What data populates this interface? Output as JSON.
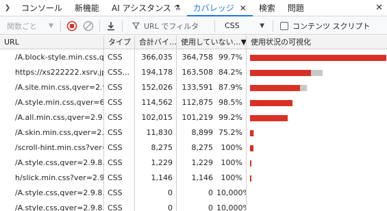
{
  "tabs": [
    {
      "label": "コンソール",
      "active": false,
      "closable": false,
      "flask": false
    },
    {
      "label": "新機能",
      "active": false,
      "closable": false,
      "flask": false
    },
    {
      "label": "AI アシスタンス",
      "active": false,
      "closable": false,
      "flask": true
    },
    {
      "label": "カバレッジ",
      "active": true,
      "closable": true,
      "flask": false
    },
    {
      "label": "検索",
      "active": false,
      "closable": false,
      "flask": false
    },
    {
      "label": "問題",
      "active": false,
      "closable": false,
      "flask": false
    }
  ],
  "toolbar": {
    "granularity": "関数ごと",
    "filter_placeholder": "URL でフィルタ",
    "type_value": "CSS",
    "content_scripts_label": "コンテンツ スクリプト",
    "content_scripts_checked": false
  },
  "table": {
    "headers": [
      "URL",
      "タイプ",
      "合計バイ…",
      "使用していない…▼",
      "使用状況の可視化"
    ],
    "rows": [
      {
        "url": "/A.block-style.min.css,qver=",
        "type": "CSS",
        "total": "366,035",
        "unused": "364,758",
        "pct": "99.7%",
        "used_frac": 0.0035,
        "size_frac": 1.0
      },
      {
        "url": "https://xs222222.xsrv.jp/",
        "type": "CSS...",
        "total": "194,178",
        "unused": "163,508",
        "pct": "84.2%",
        "used_frac": 0.158,
        "size_frac": 0.5305
      },
      {
        "url": "/A.site.min.css,qver=2.9.8.1",
        "type": "CSS",
        "total": "152,026",
        "unused": "133,591",
        "pct": "87.9%",
        "used_frac": 0.121,
        "size_frac": 0.4153
      },
      {
        "url": "/A.style.min.css,qver=6.7.1",
        "type": "CSS",
        "total": "114,562",
        "unused": "112,875",
        "pct": "98.5%",
        "used_frac": 0.015,
        "size_frac": 0.313
      },
      {
        "url": "/A.all.min.css,qver=2.9.8.1",
        "type": "CSS",
        "total": "102,015",
        "unused": "101,219",
        "pct": "99.2%",
        "used_frac": 0.008,
        "size_frac": 0.2787
      },
      {
        "url": "/A.skin.min.css,qver=2.9.8",
        "type": "CSS",
        "total": "11,830",
        "unused": "8,899",
        "pct": "75.2%",
        "used_frac": 0.248,
        "size_frac": 0.0323
      },
      {
        "url": "/scroll-hint.min.css?ver=2.",
        "type": "CSS",
        "total": "8,275",
        "unused": "8,275",
        "pct": "100%",
        "used_frac": 0.0,
        "size_frac": 0.0226
      },
      {
        "url": "/A.style.css,qver=2.9.8.1.",
        "type": "CSS",
        "total": "1,229",
        "unused": "1,229",
        "pct": "100%",
        "used_frac": 0.0,
        "size_frac": 0.0034
      },
      {
        "url": "h/slick.min.css?ver=2.9.8",
        "type": "CSS",
        "total": "1,146",
        "unused": "1,146",
        "pct": "100%",
        "used_frac": 0.0,
        "size_frac": 0.0031
      },
      {
        "url": "/A.style.css,qver=2.9.8.1.",
        "type": "CSS",
        "total": "0",
        "unused": "0",
        "pct": "10,000%",
        "used_frac": 0.0,
        "size_frac": 0.0
      },
      {
        "url": "/A.style.css,qver=2.9.8.1.",
        "type": "CSS",
        "total": "0",
        "unused": "0",
        "pct": "10,000%",
        "used_frac": 0.0,
        "size_frac": 0.0
      }
    ]
  },
  "colors": {
    "accent": "#1a73e8",
    "used_bar": "#d93025",
    "unused_bar": "#c8c8c8",
    "record": "#d93025"
  }
}
